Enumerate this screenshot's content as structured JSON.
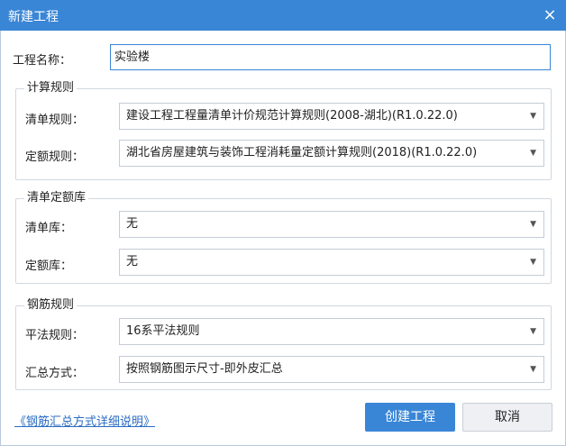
{
  "window": {
    "title": "新建工程",
    "close_glyph": "×"
  },
  "project": {
    "name_label": "工程名称：",
    "name_value": "实验楼"
  },
  "calc_rules": {
    "group_title": "计算规则",
    "bill_label": "清单规则：",
    "bill_value": "建设工程工程量清单计价规范计算规则(2008-湖北)(R1.0.22.0)",
    "quota_label": "定额规则：",
    "quota_value": "湖北省房屋建筑与装饰工程消耗量定额计算规则(2018)(R1.0.22.0)"
  },
  "libraries": {
    "group_title": "清单定额库",
    "bill_lib_label": "清单库：",
    "bill_lib_value": "无",
    "quota_lib_label": "定额库：",
    "quota_lib_value": "无"
  },
  "rebar_rules": {
    "group_title": "钢筋规则",
    "flat_rule_label": "平法规则：",
    "flat_rule_value": "16系平法规则",
    "summary_label": "汇总方式：",
    "summary_value": "按照钢筋图示尺寸-即外皮汇总"
  },
  "footer": {
    "help_link": "《钢筋汇总方式详细说明》",
    "create_button": "创建工程",
    "cancel_button": "取消"
  },
  "icons": {
    "dropdown": "chevron-down-icon",
    "close": "close-icon"
  },
  "colors": {
    "accent": "#3a86d6",
    "link": "#2b6cc4"
  }
}
